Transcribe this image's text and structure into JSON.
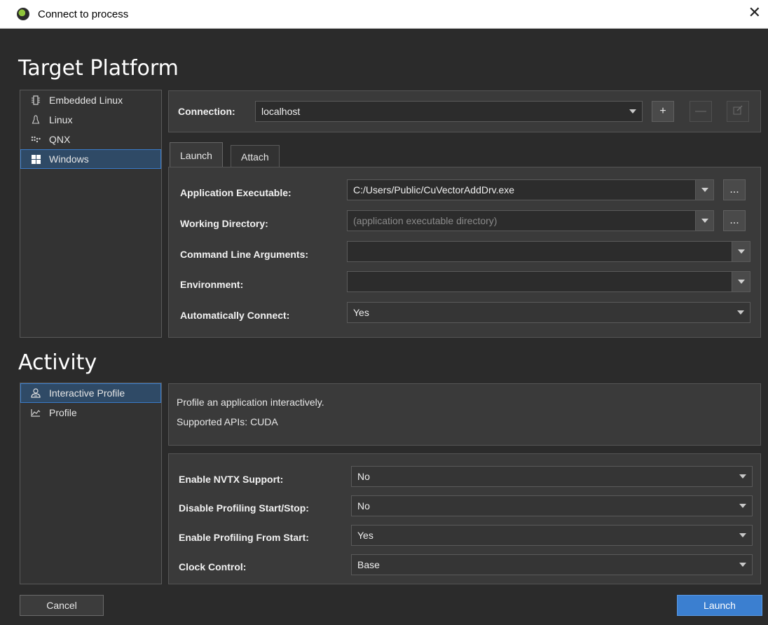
{
  "window": {
    "title": "Connect to process"
  },
  "target_platform": {
    "heading": "Target Platform",
    "platforms": [
      {
        "label": "Embedded Linux",
        "icon": "chip-icon"
      },
      {
        "label": "Linux",
        "icon": "linux-icon"
      },
      {
        "label": "QNX",
        "icon": "qnx-icon"
      },
      {
        "label": "Windows",
        "icon": "windows-icon",
        "selected": true
      }
    ],
    "connection_label": "Connection:",
    "connection_value": "localhost",
    "tabs": [
      {
        "label": "Launch",
        "active": true
      },
      {
        "label": "Attach",
        "active": false
      }
    ],
    "fields": {
      "app_exe_label": "Application Executable:",
      "app_exe_value": "C:/Users/Public/CuVectorAddDrv.exe",
      "working_dir_label": "Working Directory:",
      "working_dir_placeholder": "(application executable directory)",
      "cmd_args_label": "Command Line Arguments:",
      "cmd_args_value": "",
      "env_label": "Environment:",
      "env_value": "",
      "auto_connect_label": "Automatically Connect:",
      "auto_connect_value": "Yes"
    },
    "browse_label": "..."
  },
  "activity": {
    "heading": "Activity",
    "items": [
      {
        "label": "Interactive Profile",
        "icon": "interactive-profile-icon",
        "selected": true
      },
      {
        "label": "Profile",
        "icon": "profile-chart-icon"
      }
    ],
    "description_line1": "Profile an application interactively.",
    "description_line2": "Supported APIs: CUDA",
    "options": {
      "nvtx_label": "Enable NVTX Support:",
      "nvtx_value": "No",
      "disable_start_stop_label": "Disable Profiling Start/Stop:",
      "disable_start_stop_value": "No",
      "from_start_label": "Enable Profiling From Start:",
      "from_start_value": "Yes",
      "clock_label": "Clock Control:",
      "clock_value": "Base"
    }
  },
  "buttons": {
    "cancel": "Cancel",
    "launch": "Launch"
  },
  "colors": {
    "accent": "#3b7fd0",
    "background": "#2b2b2b",
    "selection_border": "#3a7bc8"
  }
}
